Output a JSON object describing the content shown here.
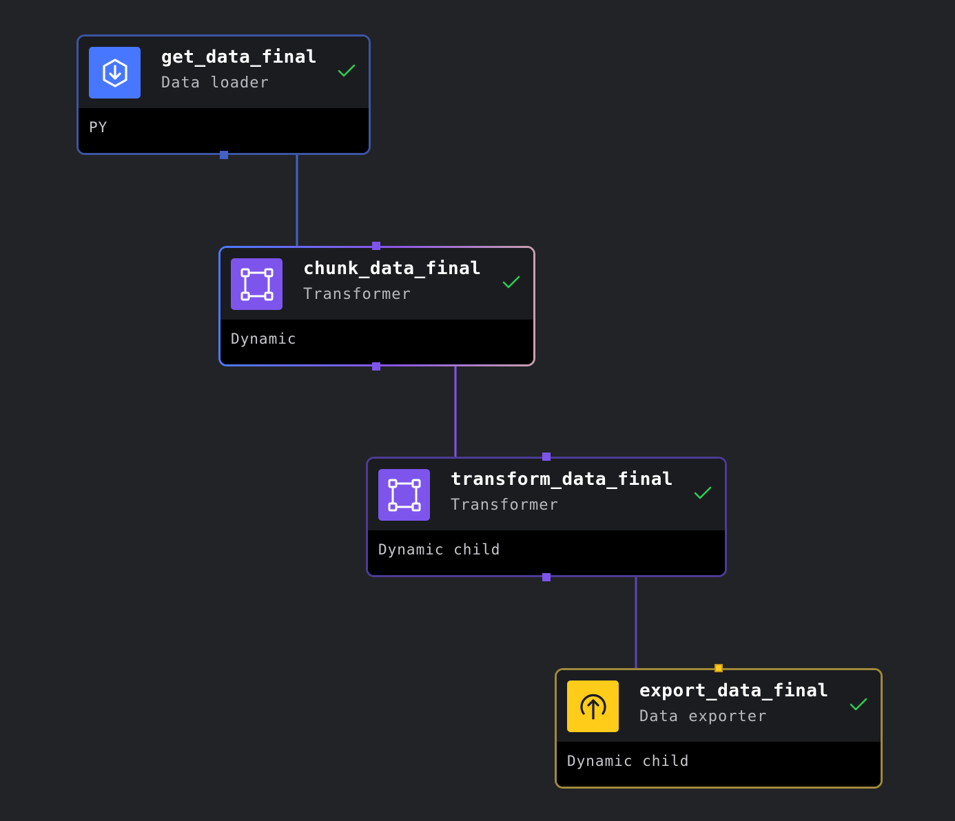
{
  "pipeline": {
    "nodes": [
      {
        "id": "get",
        "title": "get_data_final",
        "type": "Data loader",
        "footer": "PY",
        "icon": "download-icon",
        "icon_bg": "#4877ff",
        "status": "success"
      },
      {
        "id": "chunk",
        "title": "chunk_data_final",
        "type": "Transformer",
        "footer": "Dynamic",
        "icon": "transformer-icon",
        "icon_bg": "#7d55ec",
        "status": "success"
      },
      {
        "id": "transform",
        "title": "transform_data_final",
        "type": "Transformer",
        "footer": "Dynamic child",
        "icon": "transformer-icon",
        "icon_bg": "#7d55ec",
        "status": "success"
      },
      {
        "id": "export",
        "title": "export_data_final",
        "type": "Data exporter",
        "footer": "Dynamic child",
        "icon": "upload-icon",
        "icon_bg": "#ffcc19",
        "status": "success"
      }
    ],
    "edges": [
      {
        "from": "get",
        "to": "chunk",
        "color": "#4263c4"
      },
      {
        "from": "chunk",
        "to": "transform",
        "color": "#7d55ec"
      },
      {
        "from": "transform",
        "to": "export",
        "color": "#5c47b0"
      }
    ],
    "colors": {
      "background": "#222326",
      "success_check": "#2fcb52",
      "loader": "#4877ff",
      "transformer": "#7d55ec",
      "exporter": "#ffcc19"
    }
  }
}
